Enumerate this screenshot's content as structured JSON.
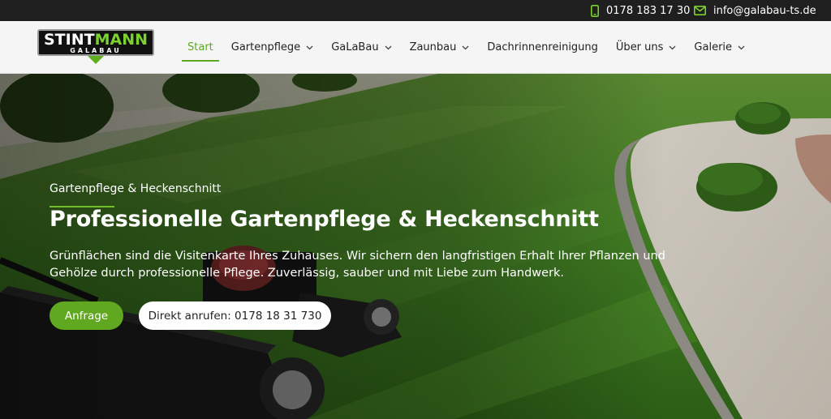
{
  "topbar": {
    "phone": "0178 183 17 30",
    "email": "info@galabau-ts.de",
    "accent_color": "#7bd12d"
  },
  "logo": {
    "word_part1": "STINT",
    "word_part2": "MANN",
    "sub": "GALABAU"
  },
  "nav": {
    "items": [
      {
        "label": "Start",
        "active": true
      },
      {
        "label": "Gartenpflege",
        "dropdown": true
      },
      {
        "label": "GaLaBau",
        "dropdown": true
      },
      {
        "label": "Zaunbau",
        "dropdown": true
      },
      {
        "label": "Dachrinnenreinigung",
        "dropdown": false
      },
      {
        "label": "Über uns",
        "dropdown": true
      },
      {
        "label": "Galerie",
        "dropdown": true
      }
    ],
    "active_color": "#5fa820"
  },
  "hero": {
    "eyebrow": "Gartenpflege & Heckenschnitt",
    "title": "Professionelle Gartenpflege & Heckenschnitt",
    "lead": "Grünflächen sind die Visitenkarte Ihres Zuhauses. Wir sichern den langfristigen Erhalt Ihrer Pflanzen und Gehölze durch professionelle Pflege. Zuverlässig, sauber und mit Liebe zum Handwerk.",
    "primary_button": "Anfrage",
    "secondary_button": "Direkt anrufen: 0178 18 31 730"
  }
}
